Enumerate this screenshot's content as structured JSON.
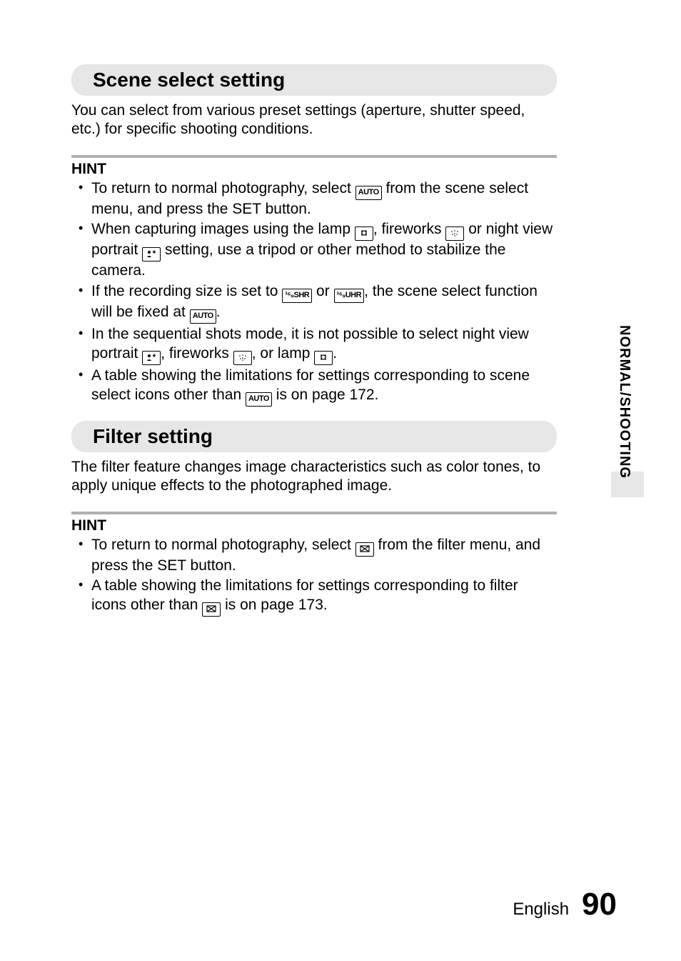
{
  "sideTab": "NORMAL/SHOOTING",
  "footer": {
    "language": "English",
    "pageNumber": "90"
  },
  "icons": {
    "auto": "AUTO",
    "shr": "¹⁶₉SHR",
    "uhr": "¹⁶₉UHR"
  },
  "section1": {
    "heading": "Scene select setting",
    "intro": "You can select from various preset settings (aperture, shutter speed, etc.) for specific shooting conditions.",
    "hintLabel": "HINT",
    "b1a": "To return to normal photography, select ",
    "b1b": " from the scene select menu, and press the SET button.",
    "b2a": "When capturing images using the lamp ",
    "b2b": ", fireworks ",
    "b2c": " or night view portrait ",
    "b2d": " setting, use a tripod or other method to stabilize the camera.",
    "b3a": "If the recording size is set to ",
    "b3b": " or ",
    "b3c": ", the scene select function will be fixed at ",
    "b3d": ".",
    "b4a": "In the sequential shots mode, it is not possible to select night view portrait ",
    "b4b": ", fireworks ",
    "b4c": ", or lamp ",
    "b4d": ".",
    "b5a": "A table showing the limitations for settings corresponding to scene select icons other than ",
    "b5b": " is on page 172."
  },
  "section2": {
    "heading": "Filter setting",
    "intro": "The filter feature changes image characteristics such as color tones, to apply unique effects to the photographed image.",
    "hintLabel": "HINT",
    "b1a": "To return to normal photography, select ",
    "b1b": " from the filter menu, and press the SET button.",
    "b2a": "A table showing the limitations for settings corresponding to filter icons other than ",
    "b2b": " is on page 173."
  }
}
